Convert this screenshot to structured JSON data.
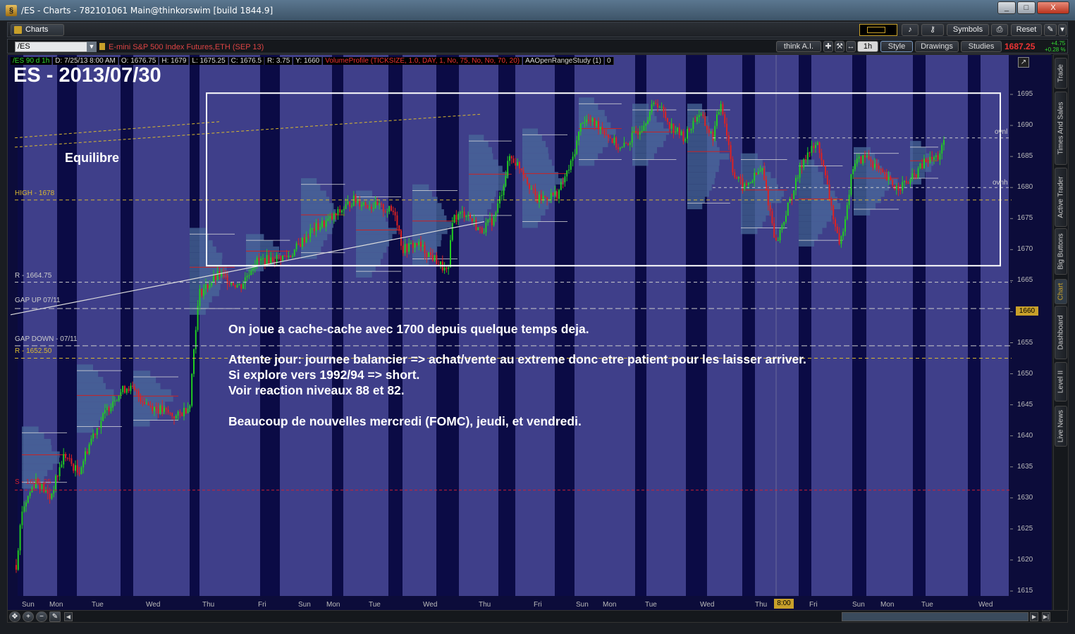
{
  "window": {
    "title": "/ES - Charts - 782101061 Main@thinkorswim [build 1844.9]",
    "minimize": "_",
    "maximize": "□",
    "close": "X"
  },
  "toolbar": {
    "tab_label": "Charts",
    "symbols_label": "Symbols",
    "reset_label": "Reset"
  },
  "symbol_bar": {
    "symbol": "/ES",
    "description": "E-mini S&P 500 Index Futures,ETH (SEP 13)",
    "think_ai_label": "think A.I.",
    "timeframe": "1h",
    "style_label": "Style",
    "drawings_label": "Drawings",
    "studies_label": "Studies",
    "last_price": "1687.25",
    "change": "+4.75",
    "change_pct": "+0.28 %"
  },
  "chart_header": {
    "symbol_period": "/ES 90 d 1h",
    "date": "D: 7/25/13 8:00 AM",
    "open": "O: 1676.75",
    "high": "H: 1679",
    "low": "L: 1675.25",
    "close": "C: 1676.5",
    "range": "R: 3.75",
    "y": "Y: 1660",
    "study1": "VolumeProfile (TICKSIZE, 1.0, DAY, 1, No, 75, No, No, 70, 20)",
    "study2": "AAOpenRangeStudy (1)",
    "study2_value": "0"
  },
  "annotations": {
    "title": "ES - 2013/07/30",
    "equilibre": "Equilibre",
    "line1": "On joue a cache-cache avec 1700 depuis quelque temps deja.",
    "line2": "Attente jour: journee balancier => achat/vente au extreme donc etre patient pour les laisser arriver.",
    "line3": "Si explore vers 1992/94 => short.",
    "line4": "Voir reaction niveaux 88 et 82.",
    "line5": "Beaucoup de nouvelles mercredi (FOMC), jeudi, et vendredi."
  },
  "levels": {
    "high": "HIGH - 1678",
    "r1": "R - 1664.75",
    "gap_up": "GAP UP 07/11",
    "gap_down": "GAP DOWN - 07/11",
    "r2": "R - 1652.50",
    "s": "S - 1631.25",
    "ovnl": "ovnl",
    "ovnh": "ovnh"
  },
  "price_axis": {
    "ticks": [
      "1695",
      "1690",
      "1685",
      "1680",
      "1675",
      "1670",
      "1665",
      "1660",
      "1655",
      "1650",
      "1645",
      "1640",
      "1635",
      "1630",
      "1625",
      "1620",
      "1615"
    ],
    "current_tag": "1660"
  },
  "time_axis": {
    "days": [
      "Sun",
      "Mon",
      "Tue",
      "Wed",
      "Thu",
      "Fri",
      "Sun",
      "Mon",
      "Tue",
      "Wed",
      "Thu",
      "Fri",
      "Sun",
      "Mon",
      "Tue",
      "Wed",
      "Thu",
      "Fri",
      "Sun",
      "Mon",
      "Tue",
      "Wed"
    ],
    "cursor_time": "8:00"
  },
  "side_tabs": [
    "Trade",
    "Times And Sales",
    "Active Trader",
    "Big Buttons",
    "Chart",
    "Dashboard",
    "Level II",
    "Live News"
  ],
  "colors": {
    "chart_bg": "#0c0c3a",
    "session_band": "#3f3f8a",
    "up_candle": "#22cc22",
    "down_candle": "#dd2222",
    "profile": "#4a6a9a",
    "level_yellow": "#d8b830",
    "level_red": "#d02030",
    "accent": "#c8a02a"
  }
}
